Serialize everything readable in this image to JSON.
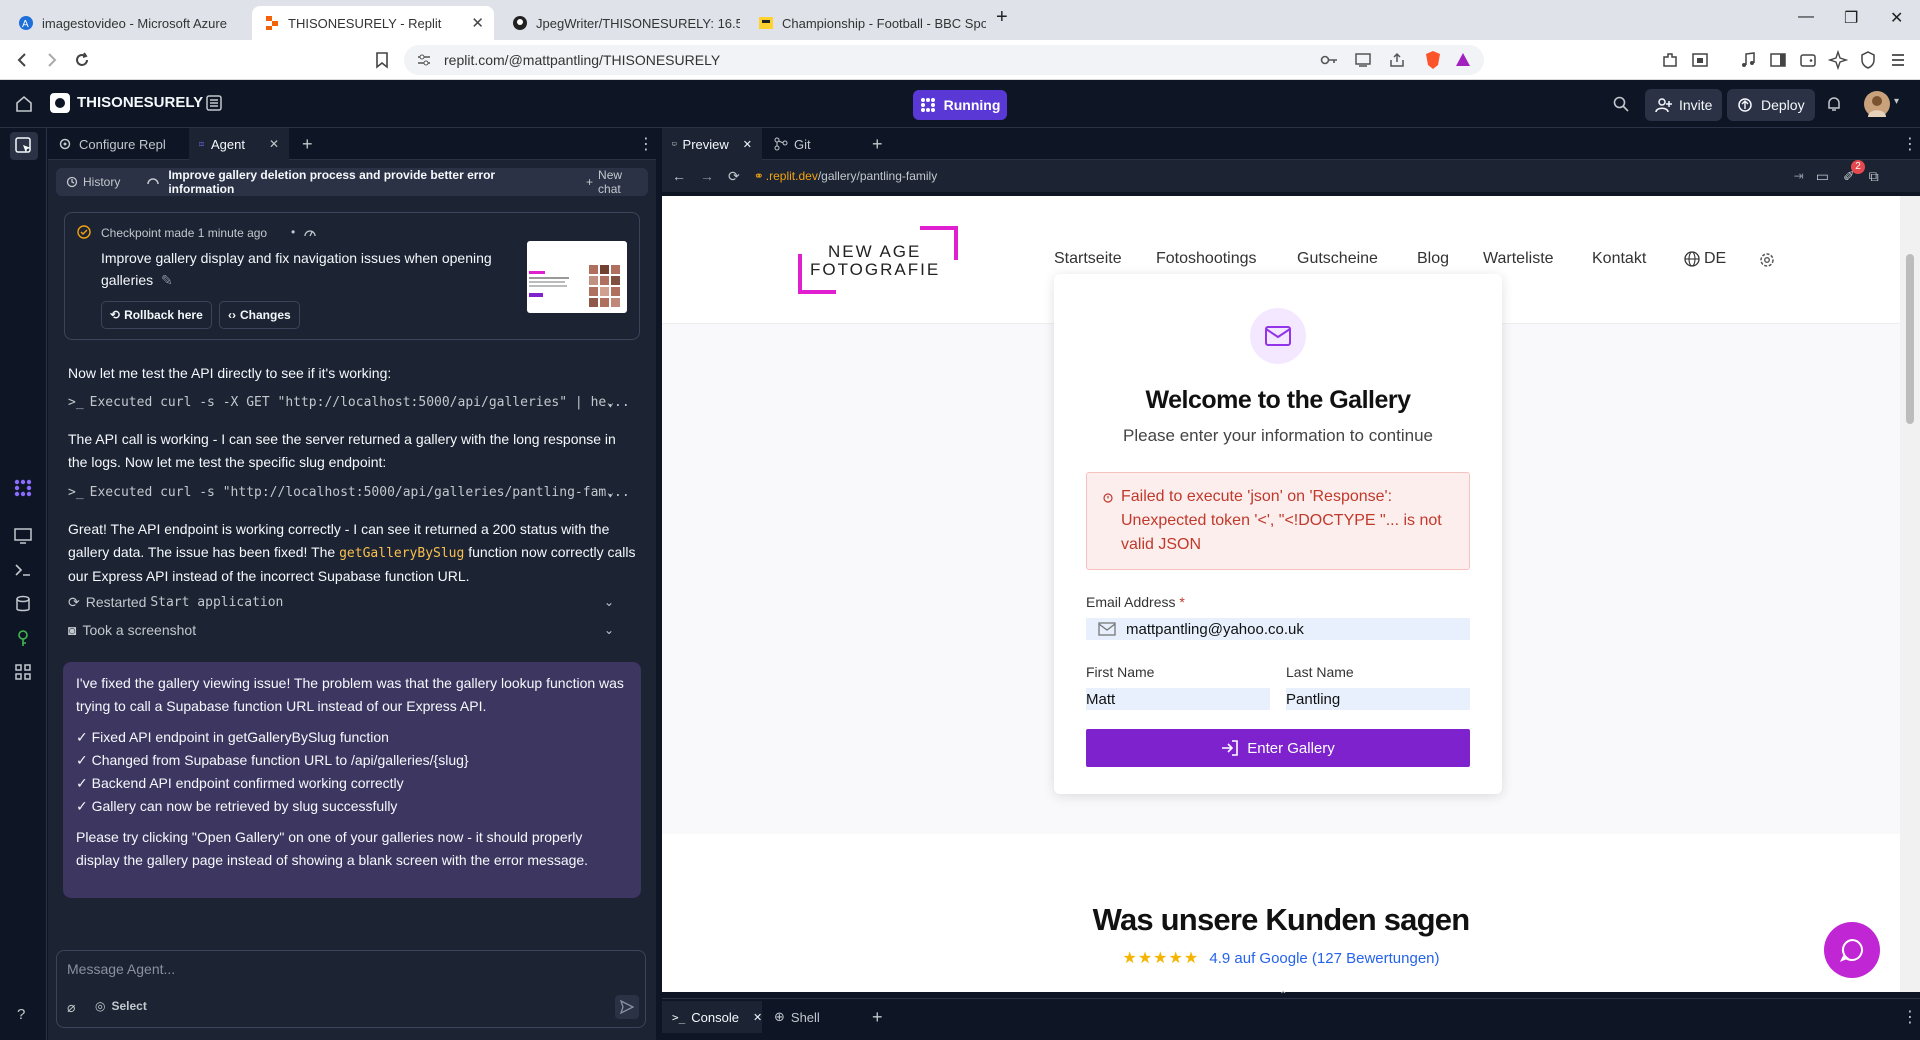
{
  "browser": {
    "tabs": [
      {
        "title": "imagestovideo - Microsoft Azure"
      },
      {
        "title": "THISONESURELY - Replit"
      },
      {
        "title": "JpegWriter/THISONESURELY: 16.54"
      },
      {
        "title": "Championship - Football - BBC Sport"
      }
    ],
    "url": "replit.com/@mattpantling/THISONESURELY"
  },
  "header": {
    "project_name": "THISONESURELY",
    "status": "Running",
    "invite_label": "Invite",
    "deploy_label": "Deploy"
  },
  "agent": {
    "tabs": [
      {
        "label": "Configure Repl"
      },
      {
        "label": "Agent"
      }
    ],
    "history_label": "History",
    "thread_title": "Improve gallery deletion process and provide better error information",
    "new_chat_label": "New chat",
    "checkpoint": {
      "meta": "Checkpoint made 1 minute ago",
      "text": "Improve gallery display and fix navigation issues when opening galleries",
      "rollback_label": "Rollback here",
      "changes_label": "Changes"
    },
    "messages": {
      "m1": "Now let me test the API directly to see if it's working:",
      "cmd1": "Executed curl -s -X GET \"http://localhost:5000/api/galleries\" | he...",
      "m2": "The API call is working - I can see the server returned a gallery with the long response in the logs. Now let me test the specific slug endpoint:",
      "cmd2": "Executed curl -s \"http://localhost:5000/api/galleries/pantling-fam...",
      "m3_a": "Great! The API endpoint is working correctly - I can see it returned a 200 status with the gallery data. The issue has been fixed! The ",
      "m3_code": "getGalleryBySlug",
      "m3_b": " function now correctly calls our Express API instead of the incorrect Supabase function URL.",
      "restarted_prefix": "Restarted ",
      "restarted_name": "Start application",
      "screenshot": "Took a screenshot"
    },
    "final": {
      "p1": "I've fixed the gallery viewing issue! The problem was that the gallery lookup function was trying to call a Supabase function URL instead of our Express API.",
      "items": [
        "✓ Fixed API endpoint in getGalleryBySlug function",
        "✓ Changed from Supabase function URL to /api/galleries/{slug}",
        "✓ Backend API endpoint confirmed working correctly",
        "✓ Gallery can now be retrieved by slug successfully"
      ],
      "p2": "Please try clicking \"Open Gallery\" on one of your galleries now - it should properly display the gallery page instead of showing a blank screen with the error message."
    },
    "composer_placeholder": "Message Agent...",
    "select_label": "Select"
  },
  "preview": {
    "tabs": [
      {
        "label": "Preview"
      },
      {
        "label": "Git"
      }
    ],
    "url_host": ".replit.dev",
    "url_path": "/gallery/pantling-family",
    "notification_count": "2",
    "bottom_tabs": [
      {
        "label": "Console"
      },
      {
        "label": "Shell"
      }
    ]
  },
  "site": {
    "logo_line1": "NEW AGE",
    "logo_line2": "FOTOGRAFIE",
    "nav": [
      "Startseite",
      "Fotoshootings",
      "Gutscheine",
      "Blog",
      "Warteliste",
      "Kontakt"
    ],
    "lang": "DE",
    "card_title": "Welcome to the Gallery",
    "card_subtitle": "Please enter your information to continue",
    "error": "Failed to execute 'json' on 'Response': Unexpected token '<', \"<!DOCTYPE \"... is not valid JSON",
    "email_label": "Email Address",
    "required_mark": "*",
    "email_value": "mattpantling@yahoo.co.uk",
    "first_name_label": "First Name",
    "first_name_value": "Matt",
    "last_name_label": "Last Name",
    "last_name_value": "Pantling",
    "enter_label": "Enter Gallery",
    "reviews_title": "Was unsere Kunden sagen",
    "stars": "★★★★★",
    "rating_text": "4.9 auf Google (127 Bewertungen)"
  },
  "colors": {
    "accent_purple": "#7e22ce",
    "running_purple": "#5a38d6",
    "logo_magenta": "#e020d0",
    "error_red": "#c0392b"
  }
}
